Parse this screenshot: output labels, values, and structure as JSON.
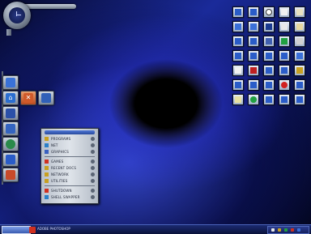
{
  "start_menu": {
    "items": [
      {
        "label": "PROGRAMS",
        "icon": "programs-icon"
      },
      {
        "label": "NET",
        "icon": "network-icon"
      },
      {
        "label": "GRAPHICS",
        "icon": "graphics-icon"
      },
      {
        "label": "GAMES",
        "icon": "games-icon"
      },
      {
        "label": "RECENT DOCS",
        "icon": "recent-docs-icon"
      },
      {
        "label": "NETWORK",
        "icon": "network-folder-icon"
      },
      {
        "label": "UTILITIES",
        "icon": "utilities-icon"
      },
      {
        "label": "SHUTDOWN",
        "icon": "shutdown-icon"
      },
      {
        "label": "SHELL SWAPPER",
        "icon": "shell-swapper-icon"
      }
    ]
  },
  "taskbar": {
    "start_label": "",
    "task_label": "ADOBE PHOTOSHOP"
  },
  "colors": {
    "accent": "#2a5cc8",
    "menu_bg": "#d4dae2",
    "taskbar": "#142060"
  }
}
